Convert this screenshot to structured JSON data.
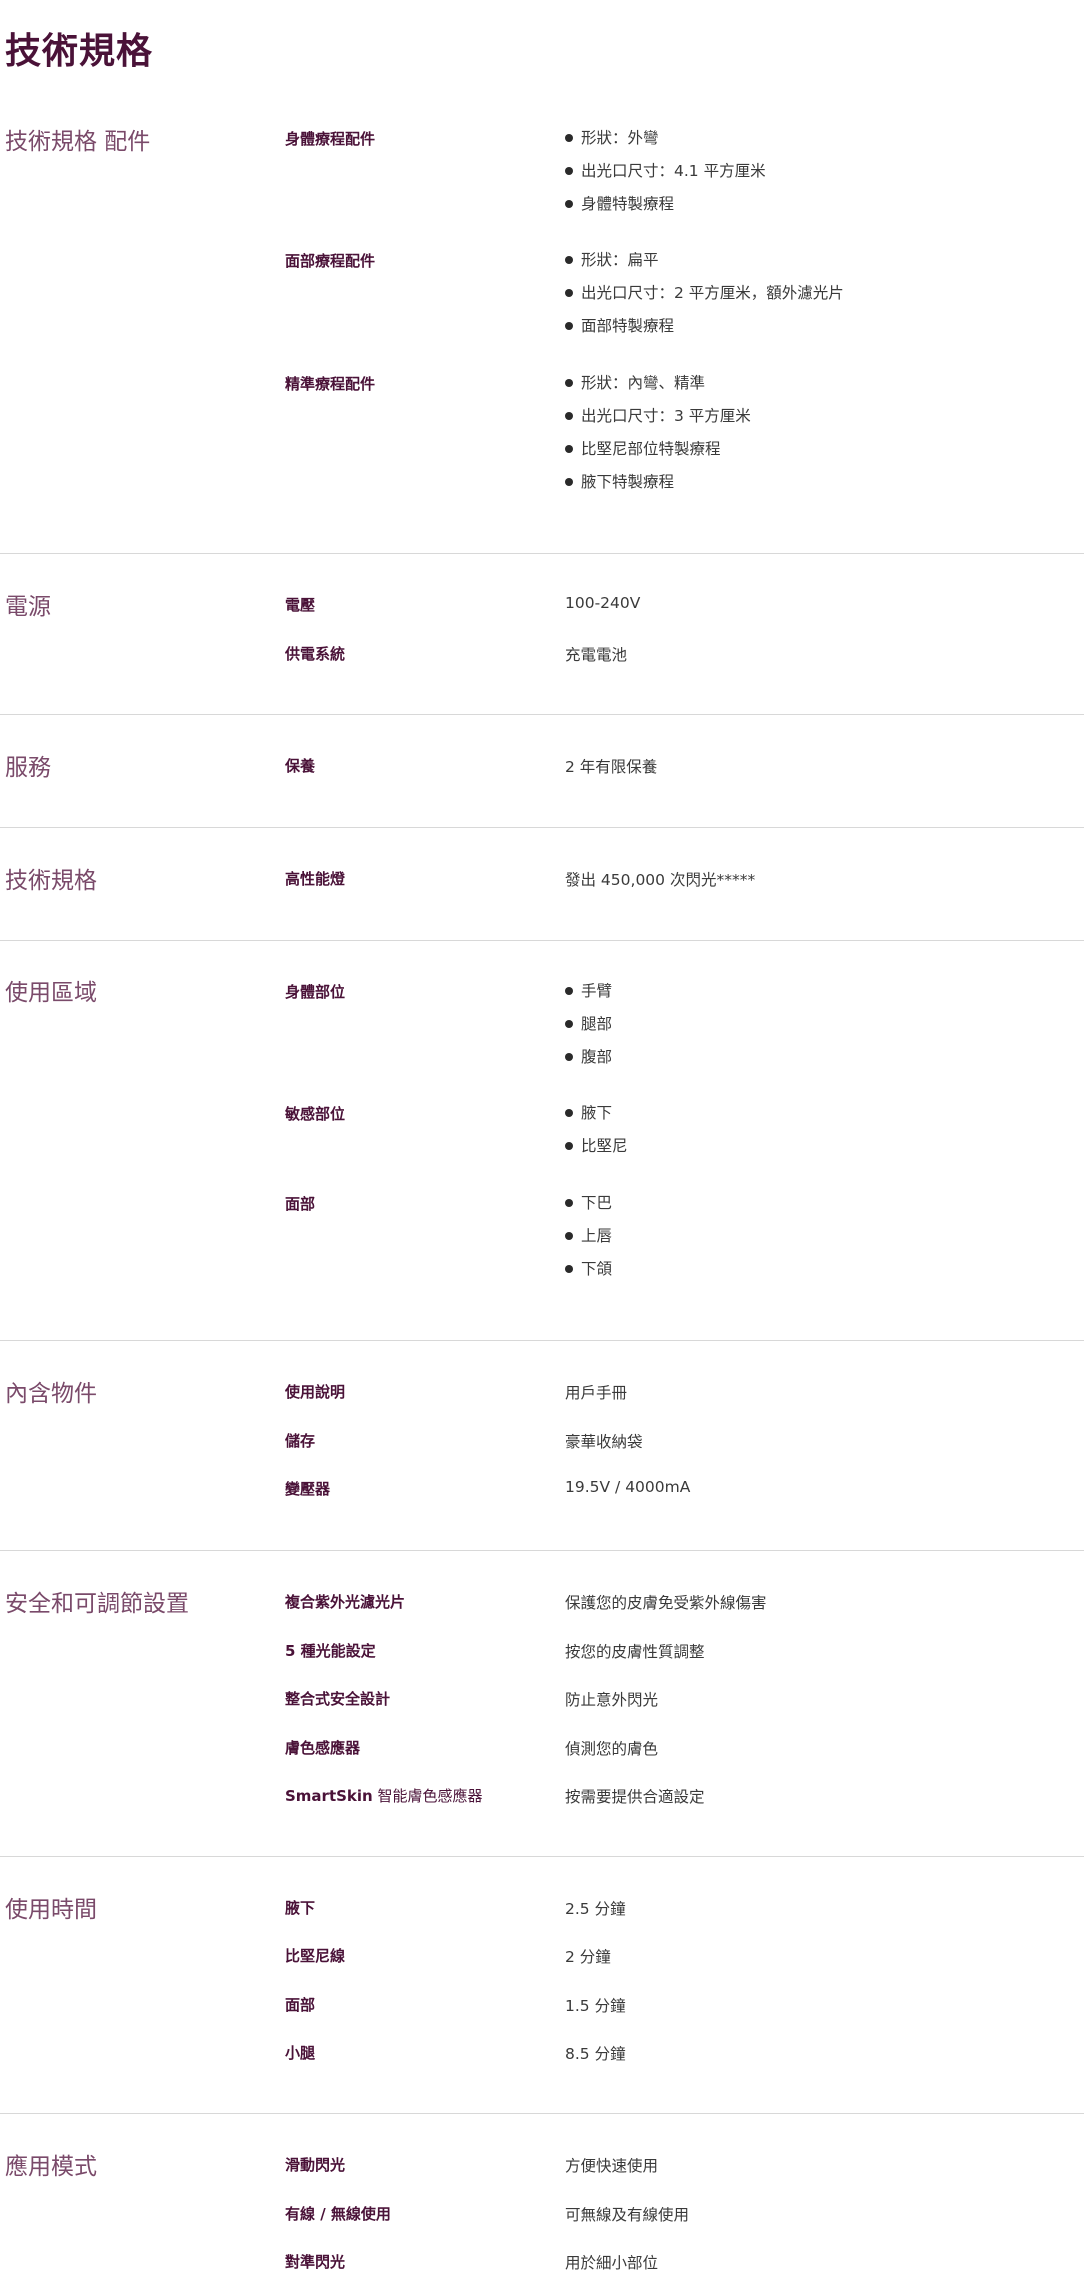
{
  "page_title": "技術規格",
  "sections": {
    "accessories": {
      "title": "技術規格 配件",
      "groups": [
        {
          "label": "身體療程配件",
          "items": [
            "形狀：外彎",
            "出光口尺寸：4.1 平方厘米",
            "身體特製療程"
          ]
        },
        {
          "label": "面部療程配件",
          "items": [
            "形狀：扁平",
            "出光口尺寸：2 平方厘米，額外濾光片",
            "面部特製療程"
          ]
        },
        {
          "label": "精準療程配件",
          "items": [
            "形狀：內彎、精準",
            "出光口尺寸：3 平方厘米",
            "比堅尼部位特製療程",
            "腋下特製療程"
          ]
        }
      ]
    },
    "power": {
      "title": "電源",
      "rows": [
        {
          "label": "電壓",
          "value": "100-240V"
        },
        {
          "label": "供電系統",
          "value": "充電電池"
        }
      ]
    },
    "service": {
      "title": "服務",
      "rows": [
        {
          "label": "保養",
          "value": "2 年有限保養"
        }
      ]
    },
    "specs": {
      "title": "技術規格",
      "rows": [
        {
          "label": "高性能燈",
          "value": "發出 450,000 次閃光*****"
        }
      ]
    },
    "usage_areas": {
      "title": "使用區域",
      "groups": [
        {
          "label": "身體部位",
          "items": [
            "手臂",
            "腿部",
            "腹部"
          ]
        },
        {
          "label": "敏感部位",
          "items": [
            "腋下",
            "比堅尼"
          ]
        },
        {
          "label": "面部",
          "items": [
            "下巴",
            "上唇",
            "下頜"
          ]
        }
      ]
    },
    "included": {
      "title": "內含物件",
      "rows": [
        {
          "label": "使用說明",
          "value": "用戶手冊"
        },
        {
          "label": "儲存",
          "value": "豪華收納袋"
        },
        {
          "label": "變壓器",
          "value": "19.5V / 4000mA"
        }
      ]
    },
    "safety": {
      "title": "安全和可調節設置",
      "rows": [
        {
          "label": "複合紫外光濾光片",
          "value": "保護您的皮膚免受紫外線傷害"
        },
        {
          "label": "5 種光能設定",
          "value": "按您的皮膚性質調整"
        },
        {
          "label": "整合式安全設計",
          "value": "防止意外閃光"
        },
        {
          "label": "膚色感應器",
          "value": "偵測您的膚色"
        },
        {
          "label_bold": "SmartSkin",
          "label_rest": " 智能膚色感應器",
          "value": "按需要提供合適設定"
        }
      ]
    },
    "time": {
      "title": "使用時間",
      "rows": [
        {
          "label": "腋下",
          "value": "2.5 分鐘"
        },
        {
          "label": "比堅尼線",
          "value": "2 分鐘"
        },
        {
          "label": "面部",
          "value": "1.5 分鐘"
        },
        {
          "label": "小腿",
          "value": "8.5 分鐘"
        }
      ]
    },
    "mode": {
      "title": "應用模式",
      "rows": [
        {
          "label": "滑動閃光",
          "value": "方便快速使用"
        },
        {
          "label": "有線 / 無線使用",
          "value": "可無線及有線使用"
        },
        {
          "label": "對準閃光",
          "value": "用於細小部位"
        }
      ]
    }
  }
}
